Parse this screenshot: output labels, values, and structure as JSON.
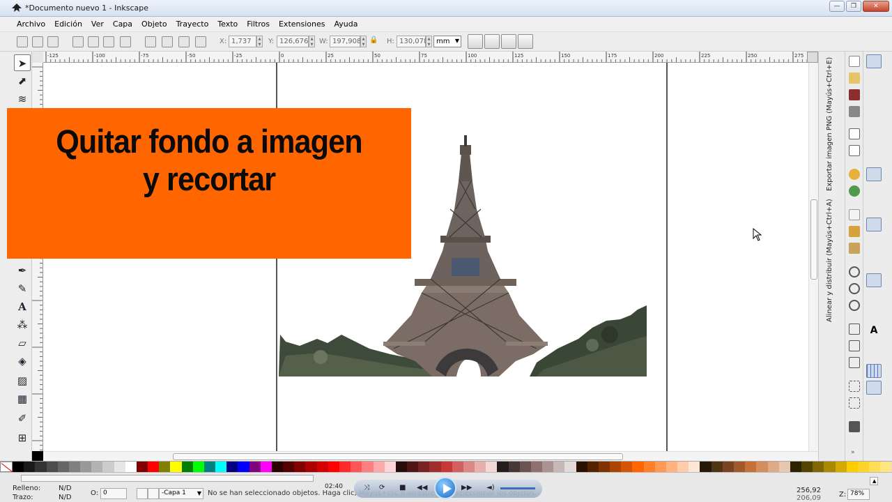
{
  "window": {
    "title": "*Documento nuevo 1 - Inkscape",
    "minimize_glyph": "—",
    "maximize_glyph": "❐",
    "close_glyph": "✕"
  },
  "menu": [
    "Archivo",
    "Edición",
    "Ver",
    "Capa",
    "Objeto",
    "Trayecto",
    "Texto",
    "Filtros",
    "Extensiones",
    "Ayuda"
  ],
  "toolcontrols": {
    "x_label": "X:",
    "x_value": "1,737",
    "y_label": "Y:",
    "y_value": "126,676",
    "w_label": "W:",
    "w_value": "197,908",
    "h_label": "H:",
    "h_value": "130,078",
    "unit": "mm"
  },
  "ruler_labels": [
    "-125",
    "-100",
    "-75",
    "-50",
    "-25",
    "0",
    "25",
    "50",
    "75",
    "100",
    "125",
    "150",
    "175",
    "200",
    "225",
    "250",
    "275"
  ],
  "banner": {
    "line1": "Quitar fondo a imagen",
    "line2": "y recortar"
  },
  "dock": {
    "tab_export": "Exportar imagen PNG (Mayús+Ctrl+E)",
    "tab_align": "Alinear y distribuir (Mayús+Ctrl+A)"
  },
  "status": {
    "fill_label": "Relleno:",
    "fill_value": "N/D",
    "stroke_label": "Trazo:",
    "stroke_value": "N/D",
    "opacity_label": "O:",
    "opacity_value": "0",
    "layer": "-Capa 1",
    "message": "No se han seleccionado objetos. Haga clic, Mayús+clic o arrastre para seleccionar los objetos.",
    "coords_x": "256,92",
    "coords_y": "206,09",
    "zoom_label": "Z:",
    "zoom": "78%"
  },
  "player": {
    "time": "02:40"
  },
  "palette_colors": [
    "#000000",
    "#1a1a1a",
    "#333333",
    "#4d4d4d",
    "#666666",
    "#808080",
    "#999999",
    "#b3b3b3",
    "#cccccc",
    "#e6e6e6",
    "#ffffff",
    "#800000",
    "#ff0000",
    "#808000",
    "#ffff00",
    "#008000",
    "#00ff00",
    "#008080",
    "#00ffff",
    "#000080",
    "#0000ff",
    "#800080",
    "#ff00ff",
    "#2b0000",
    "#550000",
    "#800000",
    "#aa0000",
    "#d40000",
    "#ff0000",
    "#ff2a2a",
    "#ff5555",
    "#ff8080",
    "#ffaaaa",
    "#ffd5d5",
    "#280b0b",
    "#501616",
    "#782121",
    "#a02c2c",
    "#c83737",
    "#d35f5f",
    "#de8787",
    "#e9afaf",
    "#f4d7d7",
    "#241c1c",
    "#483737",
    "#6c5353",
    "#916f6f",
    "#ac9393",
    "#c8b7b7",
    "#e3dbdb",
    "#2b1100",
    "#552200",
    "#803300",
    "#aa4400",
    "#d45500",
    "#ff6600",
    "#ff7f2a",
    "#ff9955",
    "#ffb380",
    "#ffccaa",
    "#ffe6d5",
    "#281a0b",
    "#503416",
    "#784421",
    "#a05a2c",
    "#c87137",
    "#d38d5f",
    "#deaa87",
    "#e9c6af",
    "#2b2200",
    "#554400",
    "#806600",
    "#aa8800",
    "#d4aa00",
    "#ffcc00",
    "#ffd42a",
    "#ffdd55",
    "#ffe680"
  ]
}
